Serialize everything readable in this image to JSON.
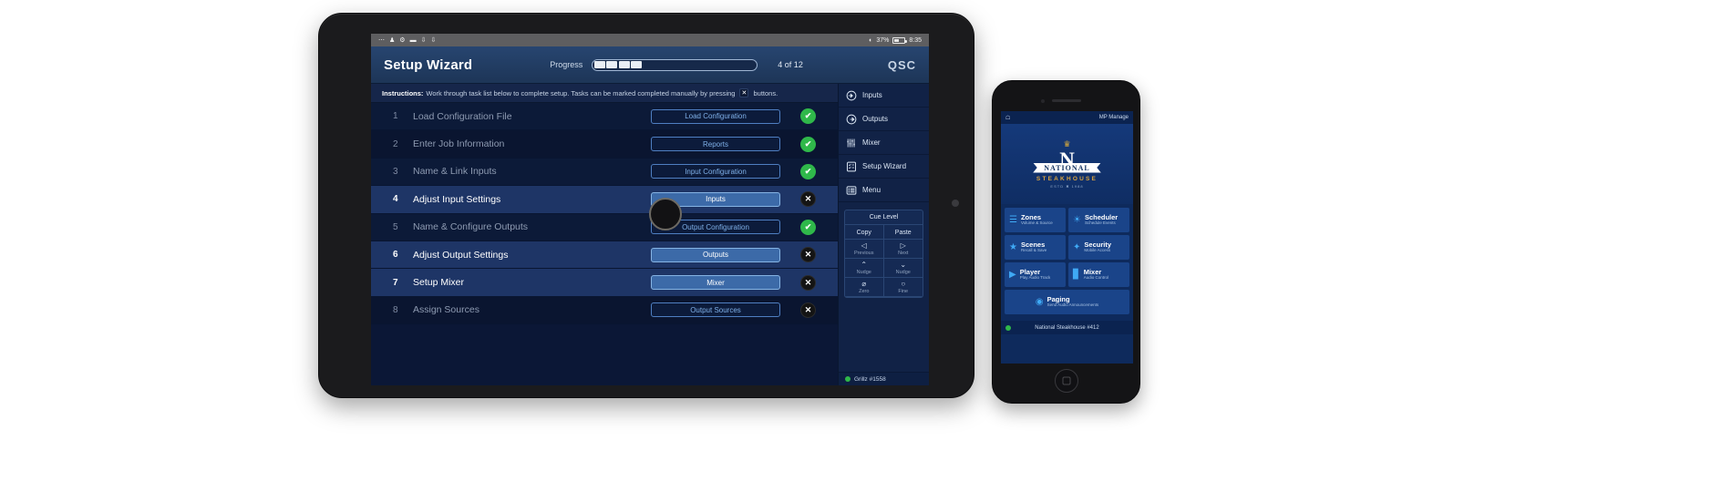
{
  "tablet": {
    "status_bar": {
      "left_icons": [
        "more-icon",
        "person-icon",
        "gear-icon",
        "display-icon",
        "download-icon",
        "download-icon"
      ],
      "wifi": "wifi-icon",
      "battery_percent": "37%",
      "time": "8:35"
    },
    "header": {
      "title": "Setup Wizard",
      "progress_label": "Progress",
      "progress_filled": 4,
      "progress_total": 12,
      "count_label": "4 of 12",
      "brand": "QSC"
    },
    "instructions": {
      "label": "Instructions:",
      "text_before": "Work through task list below to complete setup.  Tasks can be marked completed manually by pressing",
      "chip": "✕",
      "text_after": "buttons."
    },
    "tasks": [
      {
        "num": "1",
        "label": "Load Configuration File",
        "button": "Load Configuration",
        "status": "ok",
        "highlighted": false
      },
      {
        "num": "2",
        "label": "Enter Job Information",
        "button": "Reports",
        "status": "ok",
        "highlighted": false
      },
      {
        "num": "3",
        "label": "Name & Link Inputs",
        "button": "Input Configuration",
        "status": "ok",
        "highlighted": false
      },
      {
        "num": "4",
        "label": "Adjust Input Settings",
        "button": "Inputs",
        "status": "no",
        "highlighted": true
      },
      {
        "num": "5",
        "label": "Name & Configure Outputs",
        "button": "Output Configuration",
        "status": "ok",
        "highlighted": false
      },
      {
        "num": "6",
        "label": "Adjust Output Settings",
        "button": "Outputs",
        "status": "no",
        "highlighted": true
      },
      {
        "num": "7",
        "label": "Setup Mixer",
        "button": "Mixer",
        "status": "no",
        "highlighted": true
      },
      {
        "num": "8",
        "label": "Assign Sources",
        "button": "Output Sources",
        "status": "no",
        "highlighted": false
      }
    ],
    "status_marks": {
      "ok": "✔",
      "no": "✕"
    },
    "sidebar": {
      "items": [
        {
          "label": "Inputs",
          "icon": "input-arrow-icon"
        },
        {
          "label": "Outputs",
          "icon": "output-arrow-icon"
        },
        {
          "label": "Mixer",
          "icon": "faders-icon"
        },
        {
          "label": "Setup Wizard",
          "icon": "checklist-icon"
        },
        {
          "label": "Menu",
          "icon": "list-menu-icon"
        }
      ],
      "cue_panel": {
        "title": "Cue Level",
        "cells": [
          {
            "label": "Copy",
            "glyph": "",
            "sub": ""
          },
          {
            "label": "Paste",
            "glyph": "",
            "sub": ""
          },
          {
            "label": "",
            "glyph": "◁",
            "sub": "Previous"
          },
          {
            "label": "",
            "glyph": "▷",
            "sub": "Next"
          },
          {
            "label": "",
            "glyph": "⌃",
            "sub": "Nudge"
          },
          {
            "label": "",
            "glyph": "⌄",
            "sub": "Nudge"
          },
          {
            "label": "",
            "glyph": "⌀",
            "sub": "Zero"
          },
          {
            "label": "",
            "glyph": "○",
            "sub": "Fine"
          }
        ]
      },
      "footer": {
        "status": "online",
        "device": "Grillz #1558"
      }
    }
  },
  "phone": {
    "topbar": {
      "home_icon": "home-icon",
      "title": "MP Manage"
    },
    "logo": {
      "crown": "♛",
      "letter": "N",
      "ribbon": "NATIONAL",
      "subtitle": "STEAKHOUSE",
      "estd": "ESTD ✖ 1988"
    },
    "tiles": [
      {
        "title": "Zones",
        "subtitle": "Volume & Source",
        "icon": "sliders-icon",
        "wide": false
      },
      {
        "title": "Scheduler",
        "subtitle": "Schedule Events",
        "icon": "clock-icon",
        "wide": false
      },
      {
        "title": "Scenes",
        "subtitle": "Recall & Save",
        "icon": "star-icon",
        "wide": false
      },
      {
        "title": "Security",
        "subtitle": "Mobile Access",
        "icon": "key-icon",
        "wide": false
      },
      {
        "title": "Player",
        "subtitle": "Play Audio Track",
        "icon": "play-icon",
        "wide": false
      },
      {
        "title": "Mixer",
        "subtitle": "Audio Control",
        "icon": "faders-icon",
        "wide": false
      },
      {
        "title": "Paging",
        "subtitle": "Send Audio Announcements",
        "icon": "megaphone-icon",
        "wide": true
      }
    ],
    "footer": {
      "status": "online",
      "device": "National Steakhouse #412"
    }
  }
}
